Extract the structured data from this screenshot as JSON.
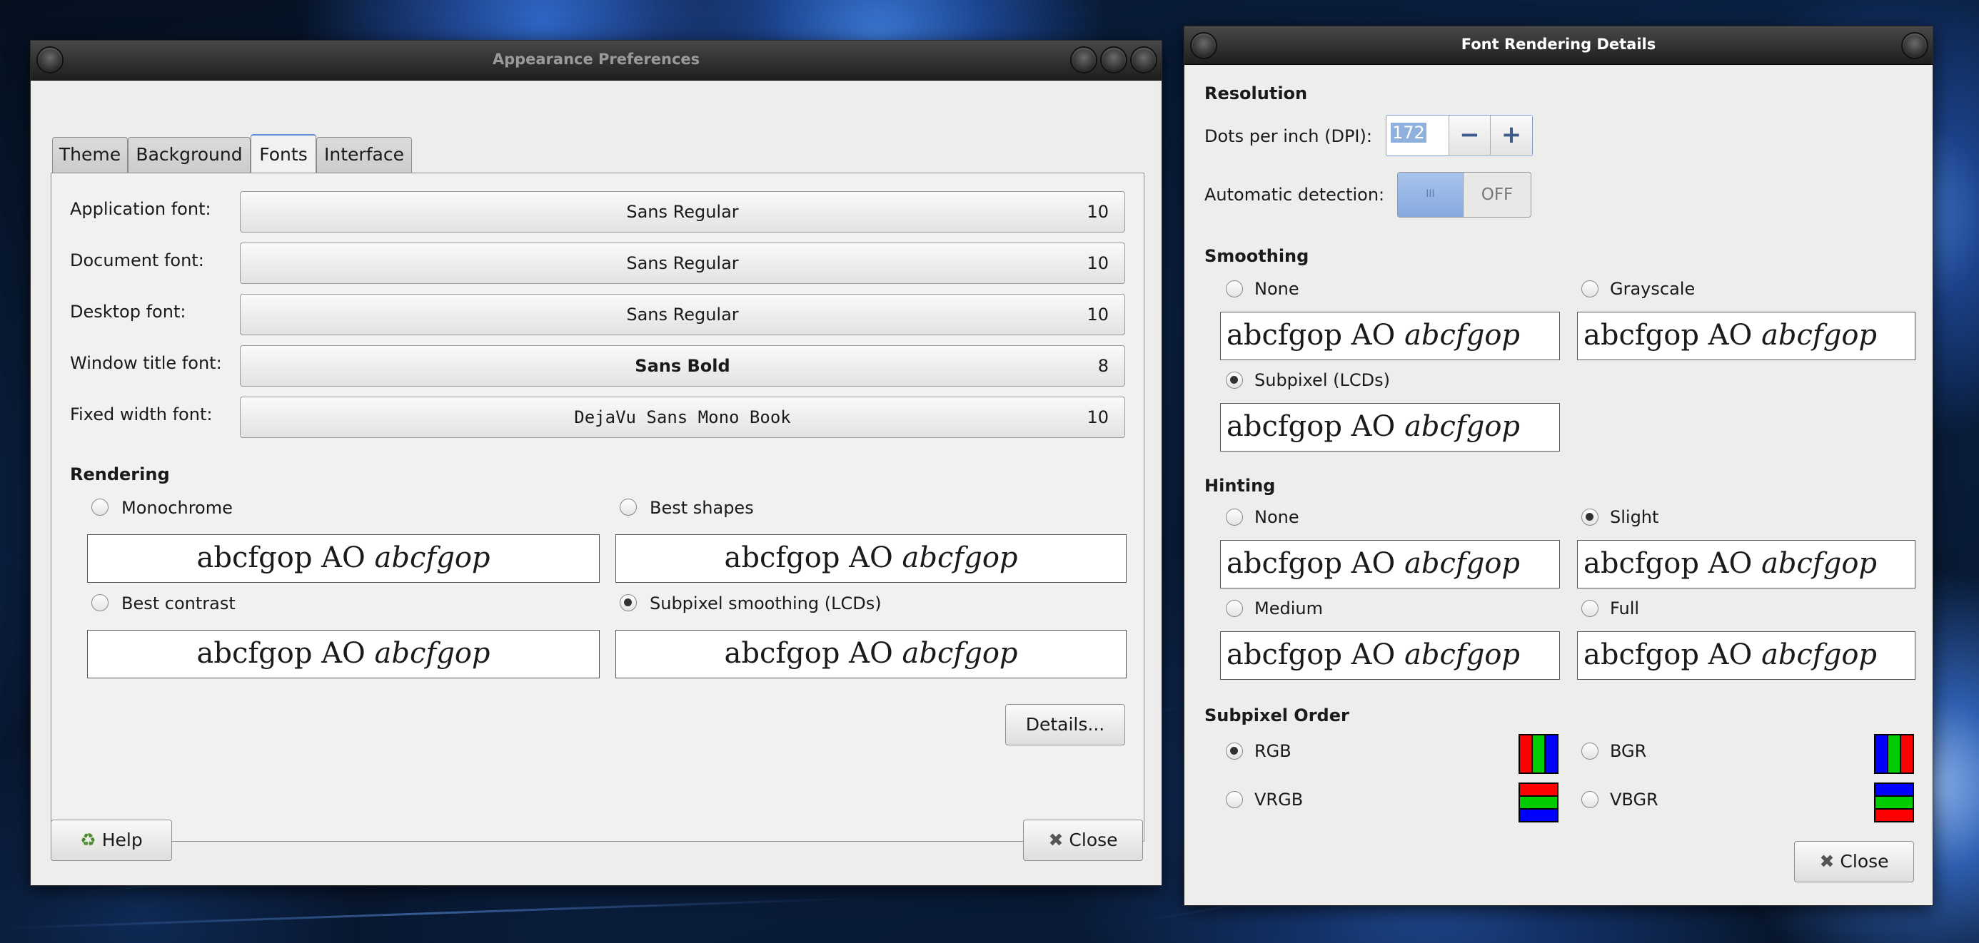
{
  "appearance": {
    "title": "Appearance Preferences",
    "tabs": [
      "Theme",
      "Background",
      "Fonts",
      "Interface"
    ],
    "active_tab": "Fonts",
    "fonts": [
      {
        "label": "Application font:",
        "name": "Sans Regular",
        "size": "10"
      },
      {
        "label": "Document font:",
        "name": "Sans Regular",
        "size": "10"
      },
      {
        "label": "Desktop font:",
        "name": "Sans Regular",
        "size": "10"
      },
      {
        "label": "Window title font:",
        "name": "Sans Bold",
        "size": "8"
      },
      {
        "label": "Fixed width font:",
        "name": "DejaVu Sans Mono Book",
        "size": "10"
      }
    ],
    "rendering": {
      "heading": "Rendering",
      "options": [
        {
          "label": "Monochrome",
          "selected": false
        },
        {
          "label": "Best shapes",
          "selected": false
        },
        {
          "label": "Best contrast",
          "selected": false
        },
        {
          "label": "Subpixel smoothing (LCDs)",
          "selected": true
        }
      ]
    },
    "sample_text": {
      "regular": "abcfgop AO ",
      "italic": "abcfgop"
    },
    "details_button": "Details...",
    "help_button": "Help",
    "close_button": "Close"
  },
  "details": {
    "title": "Font Rendering Details",
    "resolution": {
      "heading": "Resolution",
      "dpi_label": "Dots per inch (DPI):",
      "dpi_value": "172",
      "auto_label": "Automatic detection:",
      "toggle_on": "III",
      "toggle_off": "OFF"
    },
    "smoothing": {
      "heading": "Smoothing",
      "options": [
        {
          "label": "None",
          "selected": false
        },
        {
          "label": "Grayscale",
          "selected": false
        },
        {
          "label": "Subpixel (LCDs)",
          "selected": true
        }
      ]
    },
    "hinting": {
      "heading": "Hinting",
      "options": [
        {
          "label": "None",
          "selected": false
        },
        {
          "label": "Slight",
          "selected": true
        },
        {
          "label": "Medium",
          "selected": false
        },
        {
          "label": "Full",
          "selected": false
        }
      ]
    },
    "subpixel_order": {
      "heading": "Subpixel Order",
      "options": [
        {
          "label": "RGB",
          "selected": true,
          "colors": [
            "#ff0000",
            "#00cc00",
            "#0000ff"
          ],
          "orientation": "vertical"
        },
        {
          "label": "BGR",
          "selected": false,
          "colors": [
            "#0000ff",
            "#00cc00",
            "#ff0000"
          ],
          "orientation": "vertical"
        },
        {
          "label": "VRGB",
          "selected": false,
          "colors": [
            "#ff0000",
            "#00cc00",
            "#0000ff"
          ],
          "orientation": "horizontal"
        },
        {
          "label": "VBGR",
          "selected": false,
          "colors": [
            "#0000ff",
            "#00cc00",
            "#ff0000"
          ],
          "orientation": "horizontal"
        }
      ]
    },
    "close_button": "Close"
  },
  "colors": {
    "titlebar_active_text": "#ffffff",
    "titlebar_inactive_text": "#9a9a9a",
    "accent": "#5b8fd3"
  }
}
